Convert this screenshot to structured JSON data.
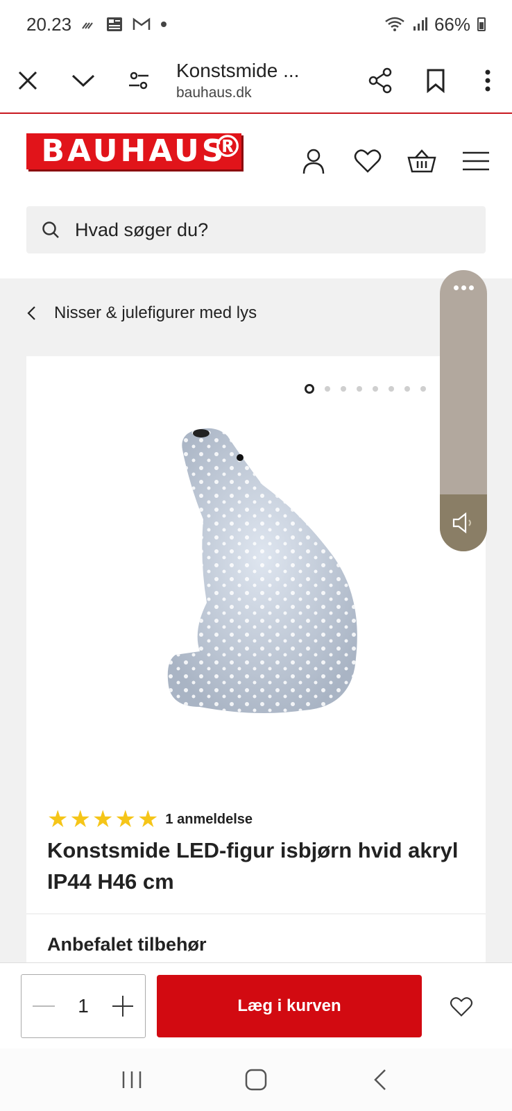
{
  "status_bar": {
    "time": "20.23",
    "battery": "66%"
  },
  "browser": {
    "title": "Konstsmide ...",
    "url": "bauhaus.dk"
  },
  "site": {
    "logo": "BAUHAUS",
    "logo_mark": "®"
  },
  "search": {
    "placeholder": "Hvad søger du?"
  },
  "breadcrumb": {
    "label": "Nisser & julefigurer med lys"
  },
  "gallery": {
    "image_count": 8,
    "active_index": 0
  },
  "product": {
    "rating": 5,
    "reviews": "1 anmeldelse",
    "title": "Konstsmide LED-figur isbjørn hvid akryl IP44 H46 cm",
    "accessories_heading": "Anbefalet tilbehør"
  },
  "cart": {
    "quantity": "1",
    "add_label": "Læg i kurven"
  },
  "colors": {
    "brand_red": "#e1141a",
    "button_red": "#d20a11",
    "star": "#f5c518"
  }
}
